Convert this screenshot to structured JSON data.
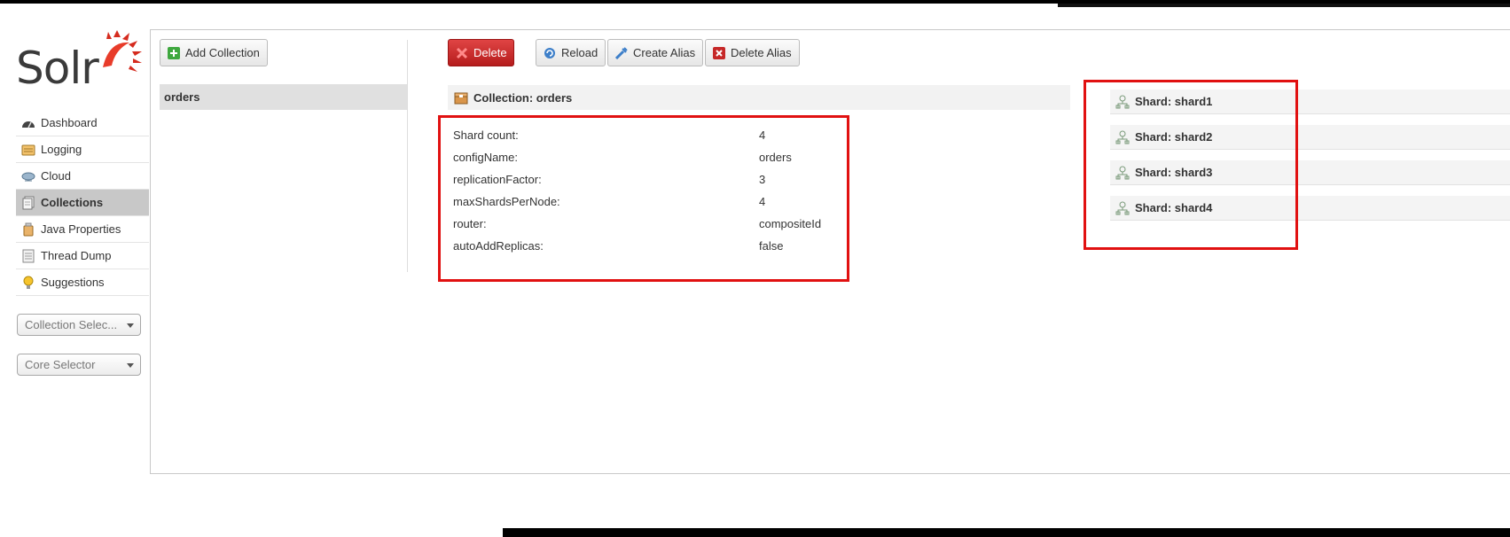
{
  "logo": {
    "text": "Solr"
  },
  "nav": {
    "items": [
      {
        "label": "Dashboard",
        "icon": "dashboard-icon"
      },
      {
        "label": "Logging",
        "icon": "logging-icon"
      },
      {
        "label": "Cloud",
        "icon": "cloud-icon"
      },
      {
        "label": "Collections",
        "icon": "collections-icon",
        "active": true
      },
      {
        "label": "Java Properties",
        "icon": "java-properties-icon"
      },
      {
        "label": "Thread Dump",
        "icon": "thread-dump-icon"
      },
      {
        "label": "Suggestions",
        "icon": "suggestions-icon"
      }
    ],
    "collection_selector": "Collection Selec...",
    "core_selector": "Core Selector"
  },
  "toolbar": {
    "add_collection": "Add Collection",
    "delete": "Delete",
    "reload": "Reload",
    "create_alias": "Create Alias",
    "delete_alias": "Delete Alias"
  },
  "collections_list": [
    "orders"
  ],
  "collection": {
    "header": "Collection: orders",
    "properties": [
      {
        "key": "Shard count:",
        "value": "4"
      },
      {
        "key": "configName:",
        "value": "orders"
      },
      {
        "key": "replicationFactor:",
        "value": "3"
      },
      {
        "key": "maxShardsPerNode:",
        "value": "4"
      },
      {
        "key": "router:",
        "value": "compositeId"
      },
      {
        "key": "autoAddReplicas:",
        "value": "false"
      }
    ]
  },
  "shards": [
    {
      "label": "Shard: shard1"
    },
    {
      "label": "Shard: shard2"
    },
    {
      "label": "Shard: shard3"
    },
    {
      "label": "Shard: shard4"
    }
  ],
  "colors": {
    "highlight_box": "#e11111",
    "delete_button": "#c62828",
    "logo_sun": "#d52b1e",
    "active_nav": "#c8c8c8"
  }
}
